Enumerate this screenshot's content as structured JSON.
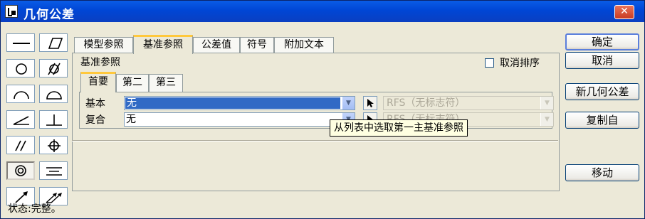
{
  "window": {
    "title": "几何公差",
    "close_icon": "close-icon"
  },
  "symbols": [
    {
      "name": "straightness-icon"
    },
    {
      "name": "flatness-icon"
    },
    {
      "name": "circularity-icon"
    },
    {
      "name": "cylindricity-icon"
    },
    {
      "name": "line-profile-icon"
    },
    {
      "name": "surface-profile-icon"
    },
    {
      "name": "angularity-icon"
    },
    {
      "name": "perpendicularity-icon"
    },
    {
      "name": "parallelism-icon"
    },
    {
      "name": "position-icon"
    },
    {
      "name": "concentricity-icon"
    },
    {
      "name": "symmetry-icon"
    },
    {
      "name": "circular-runout-icon"
    },
    {
      "name": "total-runout-icon"
    }
  ],
  "tabs": [
    "模型参照",
    "基准参照",
    "公差值",
    "符号",
    "附加文本"
  ],
  "active_tab": "基准参照",
  "panel": {
    "group_label": "基准参照",
    "unsort_checkbox_label": "取消排序",
    "unsort_checked": false,
    "subtabs": [
      "首要",
      "第二",
      "第三"
    ],
    "active_subtab": "首要",
    "rows": [
      {
        "label": "基本",
        "value": "无",
        "rfs": "RFS（无标志符）"
      },
      {
        "label": "复合",
        "value": "无",
        "rfs": "RFS（无标志符）"
      }
    ]
  },
  "tooltip": "从列表中选取第一主基准参照",
  "buttons": {
    "ok": "确定",
    "cancel": "取消",
    "new": "新几何公差",
    "copy_from": "复制自",
    "move": "移动"
  },
  "status": "状态:完整。",
  "colors": {
    "titlebar": "#0a5ce6",
    "selection": "#316ac5",
    "tab_highlight": "#ffc83c",
    "tooltip_bg": "#ffffe1"
  }
}
